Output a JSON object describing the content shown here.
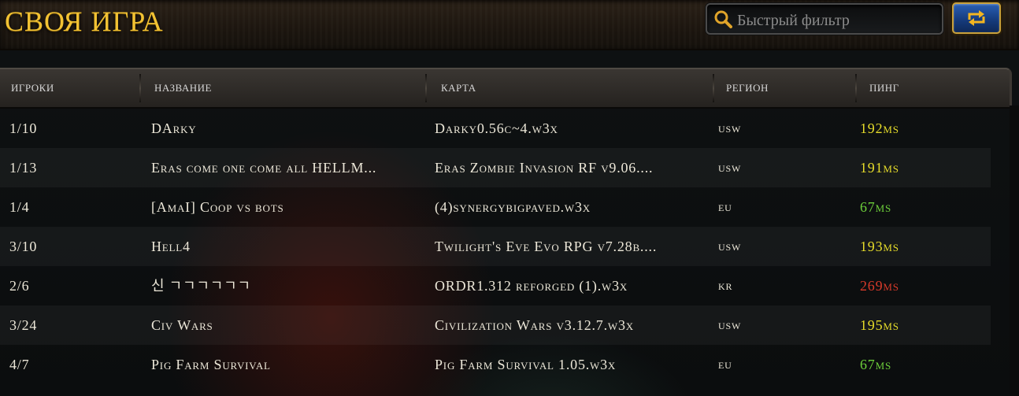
{
  "title": "СВОЯ ИГРА",
  "search": {
    "placeholder": "Быстрый фильтр",
    "value": ""
  },
  "icons": {
    "search": "magnifier-icon",
    "refresh": "refresh-icon"
  },
  "columns": {
    "players": "ИГРОКИ",
    "name": "НАЗВАНИЕ",
    "map": "КАРТА",
    "region": "РЕГИОН",
    "ping": "ПИНГ"
  },
  "ping_colors": {
    "yellow": "#e6dc2a",
    "green": "#6dcf3a",
    "red": "#d83a2a"
  },
  "games": [
    {
      "players": "1/10",
      "name": "DArky",
      "map": "Darky0.56c~4.w3x",
      "region": "usw",
      "ping": "192ms",
      "ping_color": "yellow"
    },
    {
      "players": "1/13",
      "name": "Eras come one come all HELLM...",
      "map": "Eras Zombie Invasion RF v9.06....",
      "region": "usw",
      "ping": "191ms",
      "ping_color": "yellow"
    },
    {
      "players": "1/4",
      "name": "[AmaI] Coop vs bots",
      "map": "(4)synergybigpaved.w3x",
      "region": "eu",
      "ping": "67ms",
      "ping_color": "green"
    },
    {
      "players": "3/10",
      "name": "Hell4",
      "map": "Twilight's Eve Evo RPG v7.28b....",
      "region": "usw",
      "ping": "193ms",
      "ping_color": "yellow"
    },
    {
      "players": "2/6",
      "name": "신 ㄱㄱㄱㄱㄱㄱ",
      "map": "ORDR1.312  reforged (1).w3x",
      "region": "kr",
      "ping": "269ms",
      "ping_color": "red"
    },
    {
      "players": "3/24",
      "name": "Civ Wars",
      "map": "Civilization Wars v3.12.7.w3x",
      "region": "usw",
      "ping": "195ms",
      "ping_color": "yellow"
    },
    {
      "players": "4/7",
      "name": "Pig Farm Survival",
      "map": "Pig Farm Survival 1.05.w3x",
      "region": "eu",
      "ping": "67ms",
      "ping_color": "green"
    }
  ]
}
